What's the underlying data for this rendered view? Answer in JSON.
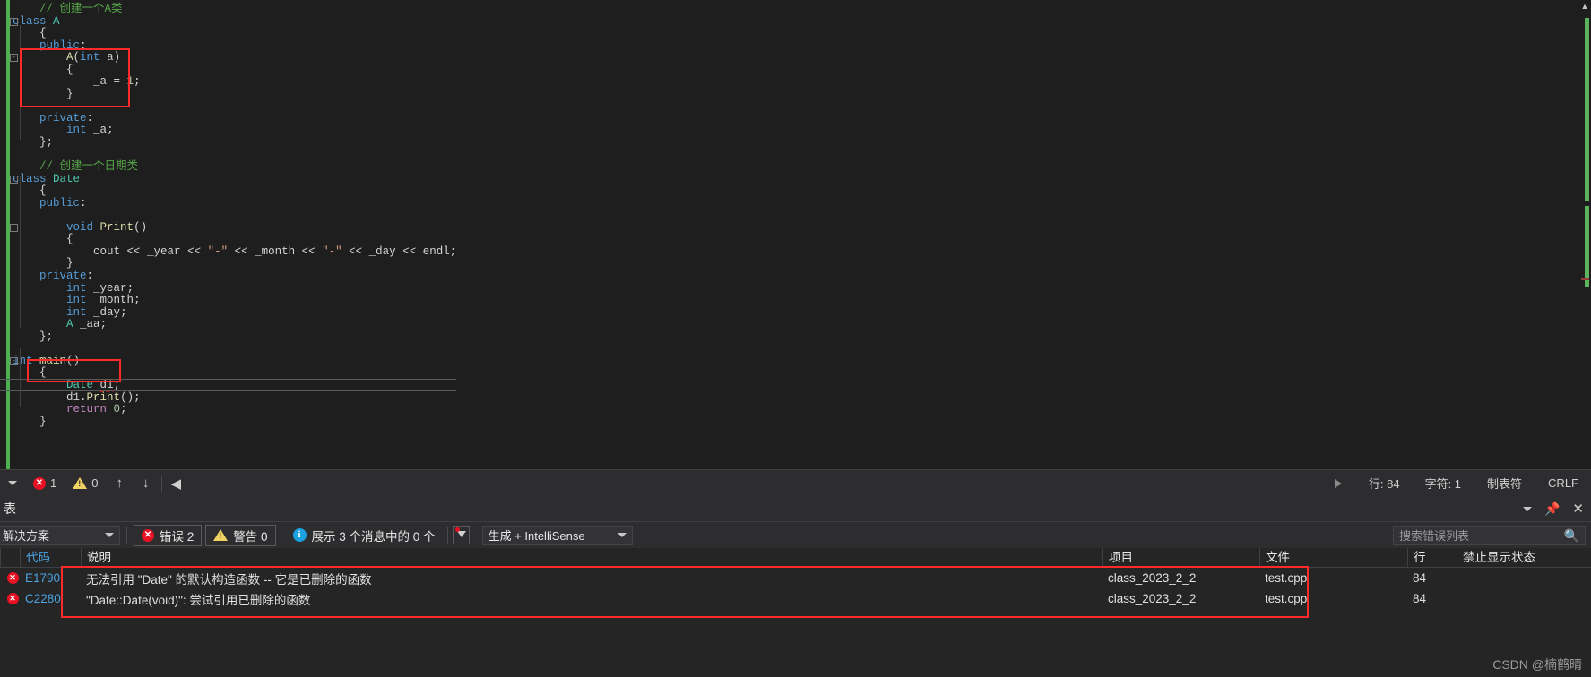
{
  "editor": {
    "language": "cpp",
    "lines": [
      {
        "indent": 1,
        "fold": "",
        "tokens": [
          {
            "t": "// 创建一个A类",
            "c": "cm"
          }
        ]
      },
      {
        "indent": 0,
        "fold": "-",
        "tokens": [
          {
            "t": "class",
            "c": "kw"
          },
          {
            "t": " ",
            "c": "pl"
          },
          {
            "t": "A",
            "c": "ty"
          }
        ]
      },
      {
        "indent": 1,
        "fold": "",
        "tokens": [
          {
            "t": "{",
            "c": "pl"
          }
        ]
      },
      {
        "indent": 1,
        "fold": "",
        "tokens": [
          {
            "t": "public",
            "c": "kw"
          },
          {
            "t": ":",
            "c": "pl"
          }
        ]
      },
      {
        "indent": 2,
        "fold": "-",
        "tokens": [
          {
            "t": "A",
            "c": "fn"
          },
          {
            "t": "(",
            "c": "pl"
          },
          {
            "t": "int",
            "c": "kw"
          },
          {
            "t": " ",
            "c": "pl"
          },
          {
            "t": "a",
            "c": "pl"
          },
          {
            "t": ")",
            "c": "pl"
          }
        ]
      },
      {
        "indent": 2,
        "fold": "",
        "tokens": [
          {
            "t": "{",
            "c": "pl"
          }
        ]
      },
      {
        "indent": 3,
        "fold": "",
        "tokens": [
          {
            "t": "_a",
            "c": "pl"
          },
          {
            "t": " = ",
            "c": "pl"
          },
          {
            "t": "1",
            "c": "nm"
          },
          {
            "t": ";",
            "c": "pl"
          }
        ]
      },
      {
        "indent": 2,
        "fold": "",
        "tokens": [
          {
            "t": "}",
            "c": "pl"
          }
        ]
      },
      {
        "indent": 0,
        "fold": "",
        "tokens": []
      },
      {
        "indent": 1,
        "fold": "",
        "tokens": [
          {
            "t": "private",
            "c": "kw"
          },
          {
            "t": ":",
            "c": "pl"
          }
        ]
      },
      {
        "indent": 2,
        "fold": "",
        "tokens": [
          {
            "t": "int",
            "c": "kw"
          },
          {
            "t": " ",
            "c": "pl"
          },
          {
            "t": "_a",
            "c": "pl"
          },
          {
            "t": ";",
            "c": "pl"
          }
        ]
      },
      {
        "indent": 1,
        "fold": "",
        "tokens": [
          {
            "t": "};",
            "c": "pl"
          }
        ]
      },
      {
        "indent": 0,
        "fold": "",
        "tokens": []
      },
      {
        "indent": 1,
        "fold": "",
        "tokens": [
          {
            "t": "// 创建一个日期类",
            "c": "cm"
          }
        ]
      },
      {
        "indent": 0,
        "fold": "-",
        "tokens": [
          {
            "t": "class",
            "c": "kw"
          },
          {
            "t": " ",
            "c": "pl"
          },
          {
            "t": "Date",
            "c": "ty"
          }
        ]
      },
      {
        "indent": 1,
        "fold": "",
        "tokens": [
          {
            "t": "{",
            "c": "pl"
          }
        ]
      },
      {
        "indent": 1,
        "fold": "",
        "tokens": [
          {
            "t": "public",
            "c": "kw"
          },
          {
            "t": ":",
            "c": "pl"
          }
        ]
      },
      {
        "indent": 0,
        "fold": "",
        "tokens": []
      },
      {
        "indent": 2,
        "fold": "-",
        "tokens": [
          {
            "t": "void",
            "c": "kw"
          },
          {
            "t": " ",
            "c": "pl"
          },
          {
            "t": "Print",
            "c": "fn"
          },
          {
            "t": "()",
            "c": "pl"
          }
        ]
      },
      {
        "indent": 2,
        "fold": "",
        "tokens": [
          {
            "t": "{",
            "c": "pl"
          }
        ]
      },
      {
        "indent": 3,
        "fold": "",
        "tokens": [
          {
            "t": "cout",
            "c": "pl"
          },
          {
            "t": " << ",
            "c": "pl"
          },
          {
            "t": "_year",
            "c": "pl"
          },
          {
            "t": " << ",
            "c": "pl"
          },
          {
            "t": "\"-\"",
            "c": "st"
          },
          {
            "t": " << ",
            "c": "pl"
          },
          {
            "t": "_month",
            "c": "pl"
          },
          {
            "t": " << ",
            "c": "pl"
          },
          {
            "t": "\"-\"",
            "c": "st"
          },
          {
            "t": " << ",
            "c": "pl"
          },
          {
            "t": "_day",
            "c": "pl"
          },
          {
            "t": " << ",
            "c": "pl"
          },
          {
            "t": "endl",
            "c": "pl"
          },
          {
            "t": ";",
            "c": "pl"
          }
        ]
      },
      {
        "indent": 2,
        "fold": "",
        "tokens": [
          {
            "t": "}",
            "c": "pl"
          }
        ]
      },
      {
        "indent": 1,
        "fold": "",
        "tokens": [
          {
            "t": "private",
            "c": "kw"
          },
          {
            "t": ":",
            "c": "pl"
          }
        ]
      },
      {
        "indent": 2,
        "fold": "",
        "tokens": [
          {
            "t": "int",
            "c": "kw"
          },
          {
            "t": " ",
            "c": "pl"
          },
          {
            "t": "_year",
            "c": "pl"
          },
          {
            "t": ";",
            "c": "pl"
          }
        ]
      },
      {
        "indent": 2,
        "fold": "",
        "tokens": [
          {
            "t": "int",
            "c": "kw"
          },
          {
            "t": " ",
            "c": "pl"
          },
          {
            "t": "_month",
            "c": "pl"
          },
          {
            "t": ";",
            "c": "pl"
          }
        ]
      },
      {
        "indent": 2,
        "fold": "",
        "tokens": [
          {
            "t": "int",
            "c": "kw"
          },
          {
            "t": " ",
            "c": "pl"
          },
          {
            "t": "_day",
            "c": "pl"
          },
          {
            "t": ";",
            "c": "pl"
          }
        ]
      },
      {
        "indent": 2,
        "fold": "",
        "tokens": [
          {
            "t": "A",
            "c": "ty"
          },
          {
            "t": " ",
            "c": "pl"
          },
          {
            "t": "_aa",
            "c": "pl"
          },
          {
            "t": ";",
            "c": "pl"
          }
        ]
      },
      {
        "indent": 1,
        "fold": "",
        "tokens": [
          {
            "t": "};",
            "c": "pl"
          }
        ]
      },
      {
        "indent": 0,
        "fold": "",
        "tokens": []
      },
      {
        "indent": 0,
        "fold": "-",
        "tokens": [
          {
            "t": "int",
            "c": "kw"
          },
          {
            "t": " ",
            "c": "pl"
          },
          {
            "t": "main",
            "c": "fn"
          },
          {
            "t": "()",
            "c": "pl"
          }
        ]
      },
      {
        "indent": 1,
        "fold": "",
        "tokens": [
          {
            "t": "{",
            "c": "pl"
          }
        ]
      },
      {
        "indent": 2,
        "fold": "",
        "current": true,
        "tokens": [
          {
            "t": "Date",
            "c": "ty"
          },
          {
            "t": " ",
            "c": "pl"
          },
          {
            "t": "d1",
            "c": "pl",
            "error": true
          },
          {
            "t": ";",
            "c": "pl"
          }
        ]
      },
      {
        "indent": 2,
        "fold": "",
        "tokens": [
          {
            "t": "d1",
            "c": "pl"
          },
          {
            "t": ".",
            "c": "pl"
          },
          {
            "t": "Print",
            "c": "fn"
          },
          {
            "t": "()",
            "c": "pl"
          },
          {
            "t": ";",
            "c": "pl"
          }
        ]
      },
      {
        "indent": 2,
        "fold": "",
        "tokens": [
          {
            "t": "return",
            "c": "mc"
          },
          {
            "t": " ",
            "c": "pl"
          },
          {
            "t": "0",
            "c": "nm"
          },
          {
            "t": ";",
            "c": "pl"
          }
        ]
      },
      {
        "indent": 1,
        "fold": "",
        "tokens": [
          {
            "t": "}",
            "c": "pl"
          }
        ]
      }
    ]
  },
  "status_bar": {
    "dropdown_icon": "chevron-down-icon",
    "error_icon": "error-icon",
    "error_count": "1",
    "warning_icon": "warning-icon",
    "warning_count": "0",
    "prev_icon": "arrow-up-icon",
    "next_icon": "arrow-down-icon",
    "collapse_icon": "triangle-left-icon",
    "expand_icon": "triangle-right-icon",
    "line_label": "行: 84",
    "char_label": "字符: 1",
    "tab_label": "制表符",
    "eol_label": "CRLF"
  },
  "error_panel": {
    "title": "表",
    "window_actions": {
      "dropdown": "chevron-down-icon",
      "pin": "pin-icon",
      "close": "close-icon"
    },
    "scope_combo": {
      "value": "解决方案",
      "chevron": "chevron-down-icon"
    },
    "filters": [
      {
        "icon": "error-icon",
        "label": "错误 2",
        "active": true
      },
      {
        "icon": "warning-icon",
        "label": "警告 0",
        "active": true
      },
      {
        "icon": "info-icon",
        "label": "展示 3 个消息中的 0 个",
        "active": false
      }
    ],
    "filter_button_icon": "filter-icon",
    "build_combo": {
      "value": "生成 + IntelliSense",
      "chevron": "chevron-down-icon"
    },
    "search": {
      "placeholder": "搜索错误列表",
      "value": "",
      "icon": "search-icon"
    },
    "columns": [
      {
        "key": "icon",
        "label": ""
      },
      {
        "key": "code",
        "label": "代码"
      },
      {
        "key": "desc",
        "label": "说明"
      },
      {
        "key": "proj",
        "label": "项目"
      },
      {
        "key": "file",
        "label": "文件"
      },
      {
        "key": "line",
        "label": "行"
      },
      {
        "key": "sup",
        "label": "禁止显示状态"
      }
    ],
    "rows": [
      {
        "icon": "error-icon",
        "code": "E1790",
        "desc": "无法引用 \"Date\" 的默认构造函数 -- 它是已删除的函数",
        "proj": "class_2023_2_2",
        "file": "test.cpp",
        "line": "84",
        "sup": ""
      },
      {
        "icon": "error-icon",
        "code": "C2280",
        "desc": "\"Date::Date(void)\": 尝试引用已删除的函数",
        "proj": "class_2023_2_2",
        "file": "test.cpp",
        "line": "84",
        "sup": ""
      }
    ]
  },
  "watermark": "CSDN @楠鹤晴",
  "colors": {
    "annotation_red": "#fe2a2a",
    "editor_bg": "#1e1e1e",
    "panel_bg": "#252526",
    "toolbar_bg": "#2d2d30",
    "change_bar_green": "#4caf50",
    "error_red": "#e81123",
    "warning_yellow": "#f0d264",
    "info_blue": "#1ba1e2",
    "code_link_blue": "#4aa3df"
  }
}
